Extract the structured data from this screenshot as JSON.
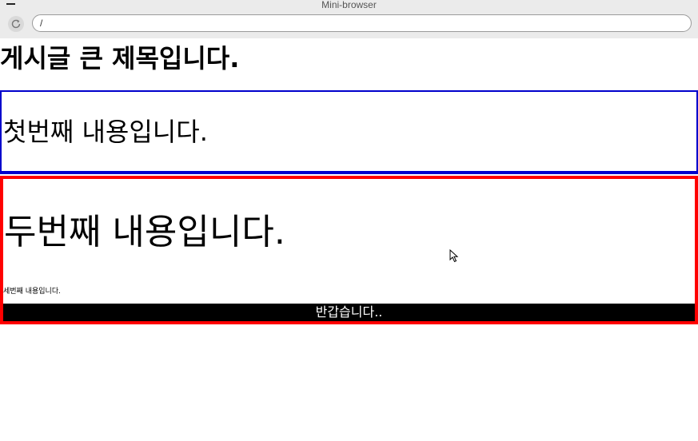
{
  "window": {
    "title": "Mini-browser"
  },
  "toolbar": {
    "url": "/"
  },
  "page": {
    "heading": "게시글 큰 제목입니다.",
    "first_content": "첫번째 내용입니다.",
    "second_content": "두번째 내용입니다.",
    "third_content": "세번째 내용입니다.",
    "banner": "반갑습니다.."
  },
  "colors": {
    "first_box_border": "#0000cc",
    "second_box_border": "#ff0000",
    "banner_background": "#000000",
    "banner_text": "#ffffff"
  },
  "icons": {
    "minimize": "minimize-icon",
    "reload": "reload-icon",
    "cursor": "mouse-pointer-icon"
  }
}
